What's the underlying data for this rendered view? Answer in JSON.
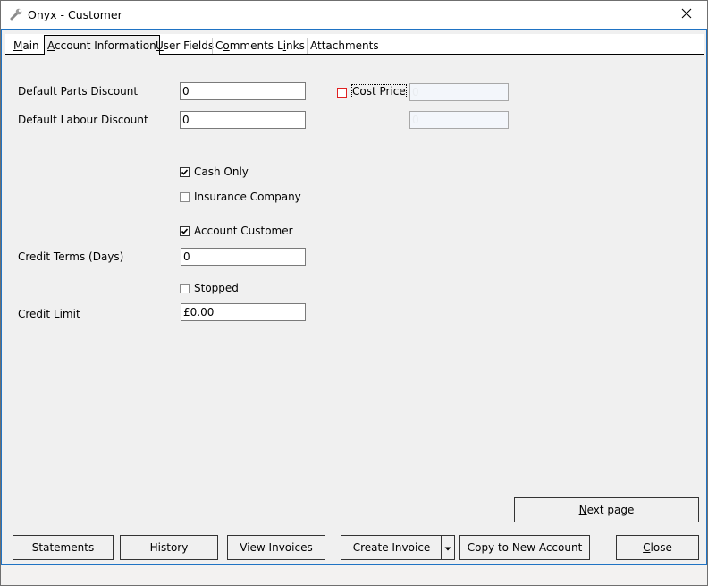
{
  "window": {
    "title": "Onyx - Customer",
    "icon": "wrench-icon",
    "close_icon": "close-icon"
  },
  "tabs": [
    {
      "label": "Main",
      "mnemonic": "M",
      "active": false
    },
    {
      "label": "Account Information",
      "mnemonic": "A",
      "active": true
    },
    {
      "label": "User Fields",
      "mnemonic": "U",
      "active": false
    },
    {
      "label": "Comments",
      "mnemonic": "o",
      "active": false
    },
    {
      "label": "Links",
      "mnemonic": "i",
      "active": false
    },
    {
      "label": "Attachments",
      "mnemonic": "",
      "active": false
    }
  ],
  "tab_parts": {
    "main": [
      "",
      "M",
      "ain"
    ],
    "account": [
      "",
      "A",
      "ccount Information"
    ],
    "user": [
      "",
      "U",
      "ser Fields"
    ],
    "comments": [
      "C",
      "o",
      "mments"
    ],
    "links": [
      "L",
      "i",
      "nks"
    ],
    "attachments": "Attachments"
  },
  "form": {
    "default_parts_discount": {
      "label": "Default Parts Discount",
      "value": "0"
    },
    "default_labour_discount": {
      "label": "Default Labour Discount",
      "value": "0"
    },
    "cost_price": {
      "label": "Cost Price",
      "checked": false,
      "parts_value": "0",
      "labour_value": "0"
    },
    "cash_only": {
      "label": "Cash Only",
      "checked": true
    },
    "insurance_company": {
      "label": "Insurance Company",
      "checked": false
    },
    "account_customer": {
      "label": "Account Customer",
      "checked": true
    },
    "credit_terms": {
      "label": "Credit Terms (Days)",
      "value": "0"
    },
    "stopped": {
      "label": "Stopped",
      "checked": false
    },
    "credit_limit": {
      "label": "Credit Limit",
      "value": "£0.00"
    }
  },
  "buttons": {
    "next_page": {
      "pre": "",
      "mnemonic": "N",
      "post": "ext page"
    },
    "statements": "Statements",
    "history": "History",
    "view_invoices": "View Invoices",
    "create_invoice": "Create Invoice",
    "create_invoice_dropdown": "dropdown-arrow-icon",
    "copy_to_new_account": "Copy to New Account",
    "close": {
      "pre": "",
      "mnemonic": "C",
      "post": "lose"
    }
  },
  "colors": {
    "frame_accent": "#1f73c4",
    "cost_price_checkbox": "#e02020"
  }
}
